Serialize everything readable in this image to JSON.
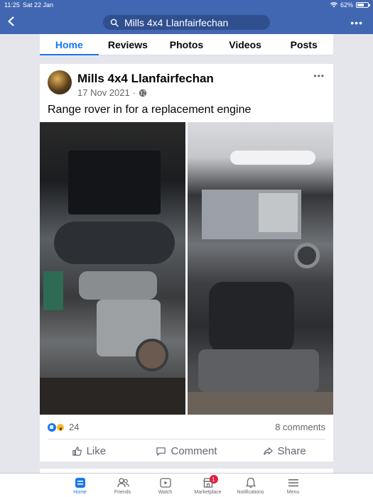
{
  "status": {
    "time": "11:25",
    "date": "Sat 22 Jan",
    "battery": "62%"
  },
  "header": {
    "search_text": "Mills 4x4 Llanfairfechan",
    "more_label": "•••"
  },
  "tabs": [
    {
      "label": "Home",
      "active": true
    },
    {
      "label": "Reviews"
    },
    {
      "label": "Photos"
    },
    {
      "label": "Videos"
    },
    {
      "label": "Posts"
    }
  ],
  "post": {
    "page_name": "Mills 4x4 Llanfairfechan",
    "date": "17 Nov 2021",
    "separator": "·",
    "text": "Range rover in for a replacement engine",
    "reaction_count": "24",
    "comment_count": "8 comments",
    "actions": {
      "like": "Like",
      "comment": "Comment",
      "share": "Share"
    }
  },
  "bottom_nav": [
    {
      "label": "Home",
      "icon": "home-icon",
      "active": true
    },
    {
      "label": "Friends",
      "icon": "friends-icon"
    },
    {
      "label": "Watch",
      "icon": "watch-icon"
    },
    {
      "label": "Marketplace",
      "icon": "marketplace-icon",
      "badge": "1"
    },
    {
      "label": "Notifications",
      "icon": "bell-icon"
    },
    {
      "label": "Menu",
      "icon": "menu-icon"
    }
  ],
  "colors": {
    "brand_blue": "#4267b2",
    "accent": "#1877f2",
    "badge_red": "#e41e3f"
  }
}
